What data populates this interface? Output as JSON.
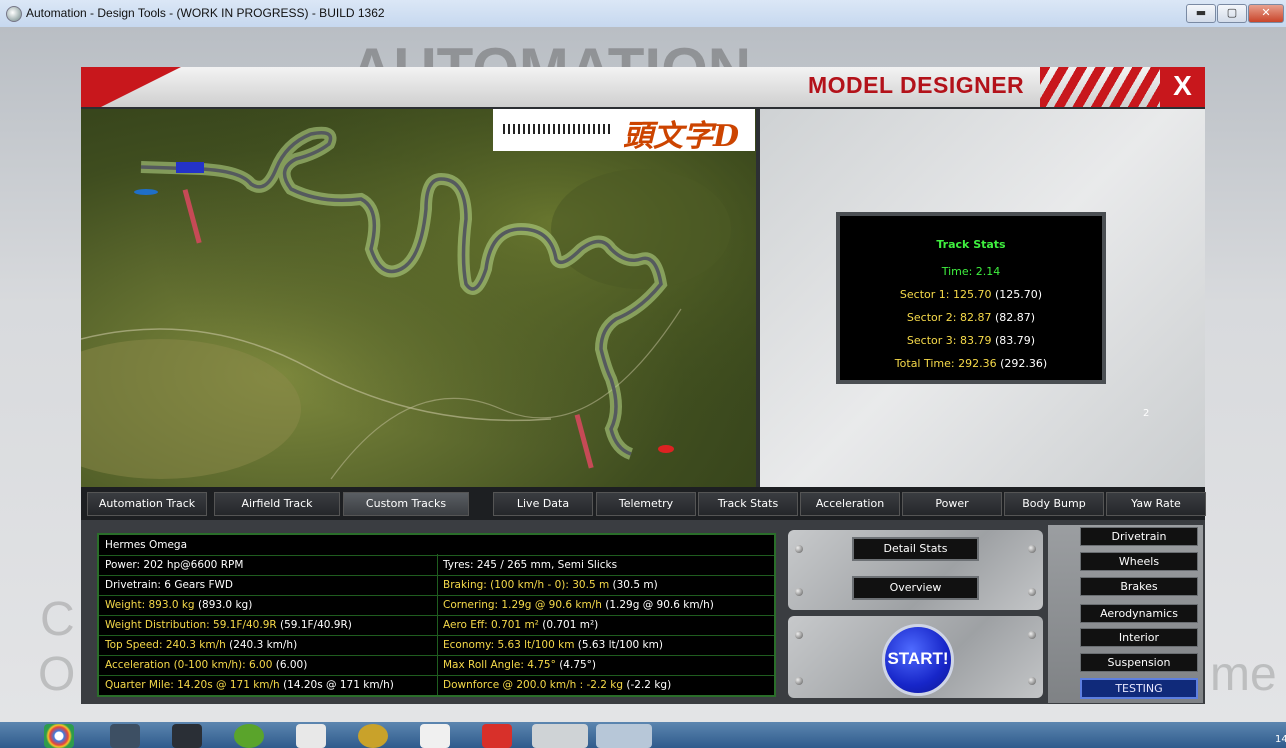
{
  "window": {
    "title": "Automation - Design Tools - (WORK IN PROGRESS) - BUILD 1362",
    "minimize": "▬",
    "maximize": "▢",
    "close": "✕"
  },
  "header": {
    "title": "MODEL DESIGNER",
    "close": "X"
  },
  "map": {
    "logo_text": "頭文字D"
  },
  "track_stats": {
    "heading": "Track Stats",
    "time_label": "Time: 2.14",
    "sector1": "Sector 1: 125.70",
    "sector1_prev": "(125.70)",
    "sector2": "Sector 2: 82.87",
    "sector2_prev": "(82.87)",
    "sector3": "Sector 3: 83.79",
    "sector3_prev": "(83.79)",
    "total": "Total Time: 292.36",
    "total_prev": "(292.36)",
    "page_number": "2"
  },
  "tabs": [
    {
      "label": "Automation Track"
    },
    {
      "label": "Airfield Track"
    },
    {
      "label": "Custom Tracks"
    },
    {
      "label": "Live Data"
    },
    {
      "label": "Telemetry"
    },
    {
      "label": "Track Stats"
    },
    {
      "label": "Acceleration"
    },
    {
      "label": "Power"
    },
    {
      "label": "Body Bump"
    },
    {
      "label": "Yaw Rate"
    }
  ],
  "car_info": {
    "name": "Hermes Omega",
    "power": "Power: 202 hp@6600 RPM",
    "tyres": "Tyres: 245 / 265 mm, Semi Slicks",
    "drivetrain": "Drivetrain: 6 Gears FWD",
    "braking": "Braking: (100 km/h - 0): 30.5 m",
    "braking_prev": "(30.5 m)",
    "weight": "Weight: 893.0 kg",
    "weight_prev": "(893.0 kg)",
    "cornering": "Cornering: 1.29g @ 90.6 km/h",
    "cornering_prev": "(1.29g @ 90.6 km/h)",
    "weight_dist": "Weight Distribution: 59.1F/40.9R",
    "weight_dist_prev": "(59.1F/40.9R)",
    "aero": "Aero Eff: 0.701 m²",
    "aero_prev": "(0.701 m²)",
    "top_speed": "Top Speed: 240.3 km/h",
    "top_speed_prev": "(240.3 km/h)",
    "economy": "Economy: 5.63 lt/100 km",
    "economy_prev": "(5.63 lt/100 km)",
    "accel": "Acceleration (0-100 km/h): 6.00",
    "accel_prev": "(6.00)",
    "roll": "Max Roll Angle: 4.75°",
    "roll_prev": "(4.75°)",
    "quarter": "Quarter Mile: 14.20s @ 171 km/h",
    "quarter_prev": "(14.20s @ 171 km/h)",
    "downforce": "Downforce @ 200.0 km/h : -2.2 kg",
    "downforce_prev": "(-2.2 kg)"
  },
  "controls": {
    "detail_stats": "Detail Stats",
    "overview": "Overview",
    "start": "START!"
  },
  "sidebar": [
    {
      "label": "Drivetrain"
    },
    {
      "label": "Wheels"
    },
    {
      "label": "Brakes"
    },
    {
      "label": "Aerodynamics"
    },
    {
      "label": "Interior"
    },
    {
      "label": "Suspension"
    },
    {
      "label": "TESTING"
    }
  ],
  "taskbar": {
    "clock": "14"
  }
}
